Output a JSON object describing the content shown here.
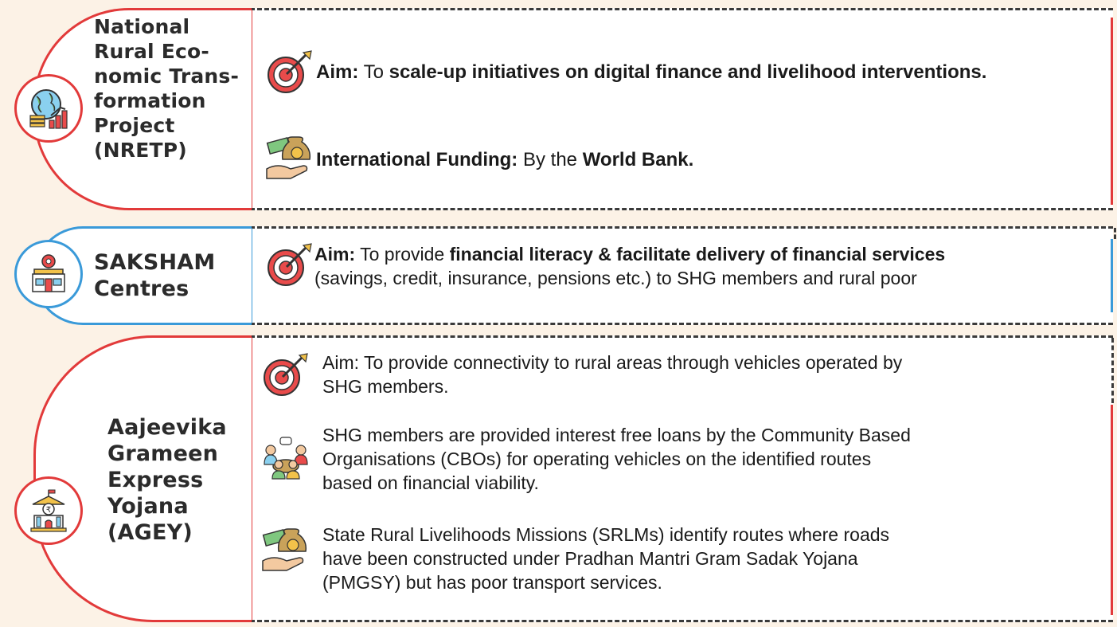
{
  "colors": {
    "background": "#fcf2e6",
    "red": "#e23a3a",
    "blue": "#3a9ad9",
    "dash": "#3a3a3a"
  },
  "sections": [
    {
      "title": "National Rural Eco-nomic Trans-formation Project (NRETP)",
      "title_lines": [
        "National",
        "Rural Eco-",
        "nomic Trans-",
        "formation",
        "Project",
        "(NRETP)"
      ],
      "icon": "globe-finance-icon",
      "items": [
        {
          "icon": "target-arrow-icon",
          "label": "Aim:",
          "pre": "To",
          "bold": "scale-up initiatives on digital finance and livelihood interventions."
        },
        {
          "icon": "money-bag-hand-icon",
          "label": "International Funding:",
          "pre": "By the",
          "bold": "World Bank."
        }
      ]
    },
    {
      "title": "SAKSHAM Centres",
      "title_lines": [
        "SAKSHAM",
        "Centres"
      ],
      "icon": "bank-gear-icon",
      "items": [
        {
          "icon": "target-arrow-icon",
          "label": "Aim:",
          "pre": "To provide",
          "bold": "financial literacy & facilitate delivery of financial services",
          "line2": "(savings, credit, insurance, pensions etc.) to SHG members and rural poor"
        }
      ]
    },
    {
      "title": "Aajeevika Grameen Express Yojana (AGEY)",
      "title_lines": [
        "Aajeevika",
        "Grameen",
        "Express",
        "Yojana",
        "(AGEY)"
      ],
      "icon": "rupee-building-icon",
      "items": [
        {
          "icon": "target-arrow-icon",
          "lines": [
            "Aim: To provide connectivity to rural areas through vehicles operated by",
            "SHG members."
          ]
        },
        {
          "icon": "group-meeting-icon",
          "lines": [
            "SHG members are provided interest free loans by the Community Based",
            "Organisations (CBOs) for operating vehicles on the identified routes",
            "based on financial viability."
          ]
        },
        {
          "icon": "money-bag-hand-icon",
          "lines": [
            "State Rural Livelihoods Missions (SRLMs) identify routes where roads",
            "have been constructed under Pradhan Mantri Gram Sadak Yojana",
            "(PMGSY) but has poor transport services."
          ]
        }
      ]
    }
  ]
}
